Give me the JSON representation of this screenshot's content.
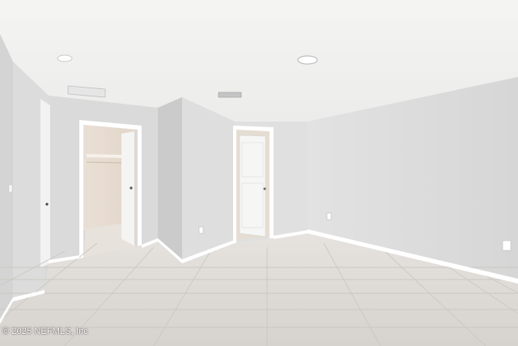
{
  "photo": {
    "subject": "empty bedroom with tile floor, closet and interior doors",
    "watermark": "© 2025 NEFMLS, Inc"
  },
  "colors": {
    "ceiling": "#f1f1f0",
    "wall_light": "#e4e4e4",
    "wall_mid": "#d8d8d8",
    "wall_dark": "#c9c9c9",
    "floor": "#dedbd7",
    "grout": "#cfcbc6",
    "trim": "#ffffff",
    "closet_interior": "#e8ddd3"
  }
}
